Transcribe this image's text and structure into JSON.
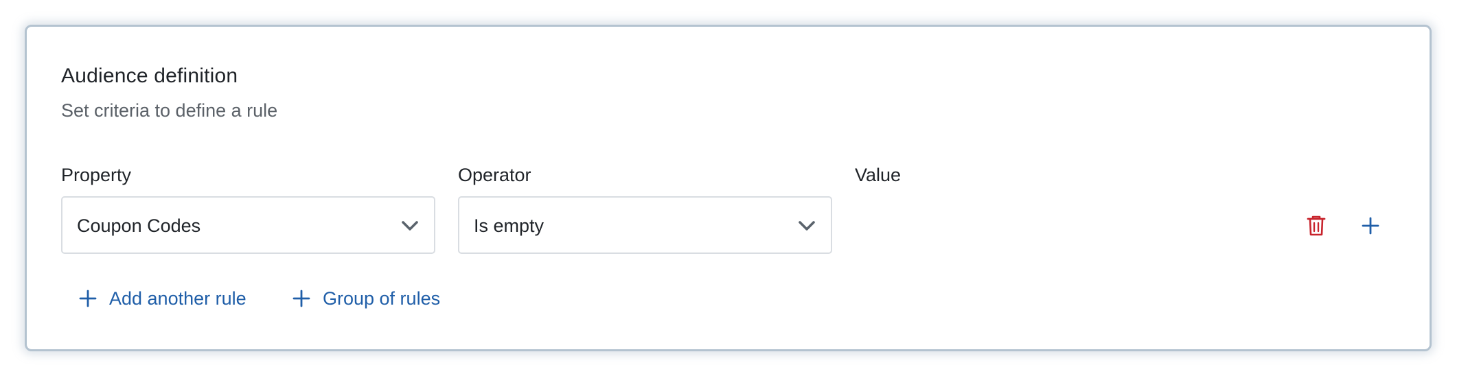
{
  "audience": {
    "title": "Audience definition",
    "subtitle": "Set criteria to define a rule"
  },
  "rule": {
    "property_label": "Property",
    "property_value": "Coupon Codes",
    "operator_label": "Operator",
    "operator_value": "Is empty",
    "value_label": "Value"
  },
  "actions": {
    "add_rule_label": "Add another rule",
    "group_rules_label": "Group of rules"
  },
  "icons": {
    "delete": "trash-icon",
    "add": "plus-icon",
    "dropdown": "chevron-down-icon"
  },
  "colors": {
    "link_blue": "#1f5ea8",
    "delete_red": "#c8242d",
    "card_border": "#b4c3d0"
  }
}
